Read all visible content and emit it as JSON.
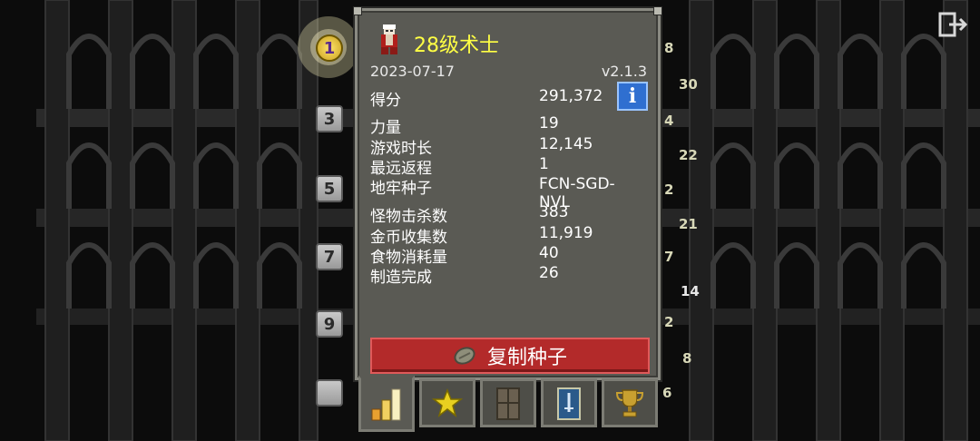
{
  "hero": {
    "title": "28级术士",
    "date": "2023-07-17",
    "version": "v2.1.3",
    "icon": "warlock-hero-icon"
  },
  "stats": {
    "score_label": "得分",
    "score_value": "291,372",
    "strength_label": "力量",
    "strength_value": "19",
    "playtime_label": "游戏时长",
    "playtime_value": "12,145",
    "ascent_label": "最远返程",
    "ascent_value": "1",
    "seed_label": "地牢种子",
    "seed_value": "FCN-SGD-NVL",
    "kills_label": "怪物击杀数",
    "kills_value": "383",
    "gold_label": "金币收集数",
    "gold_value": "11,919",
    "food_label": "食物消耗量",
    "food_value": "40",
    "crafted_label": "制造完成",
    "crafted_value": "26"
  },
  "info_button": {
    "label": "i"
  },
  "copy_seed_button": {
    "label": "复制种子"
  },
  "tabs": [
    {
      "icon": "stats-bars-icon",
      "active": true
    },
    {
      "icon": "star-icon",
      "active": false
    },
    {
      "icon": "door-icon",
      "active": false
    },
    {
      "icon": "sword-scroll-icon",
      "active": false
    },
    {
      "icon": "trophy-icon",
      "active": false
    }
  ],
  "background": {
    "rank_badges": [
      "1",
      "3",
      "5",
      "7",
      "9"
    ],
    "side_numbers": [
      "8",
      "30",
      "4",
      "22",
      "2",
      "21",
      "7",
      "14",
      "2",
      "8",
      "6"
    ],
    "colors": {
      "title": "#ffff44",
      "copy_button": "#b32a2a",
      "info_button": "#2f6fd0"
    }
  }
}
